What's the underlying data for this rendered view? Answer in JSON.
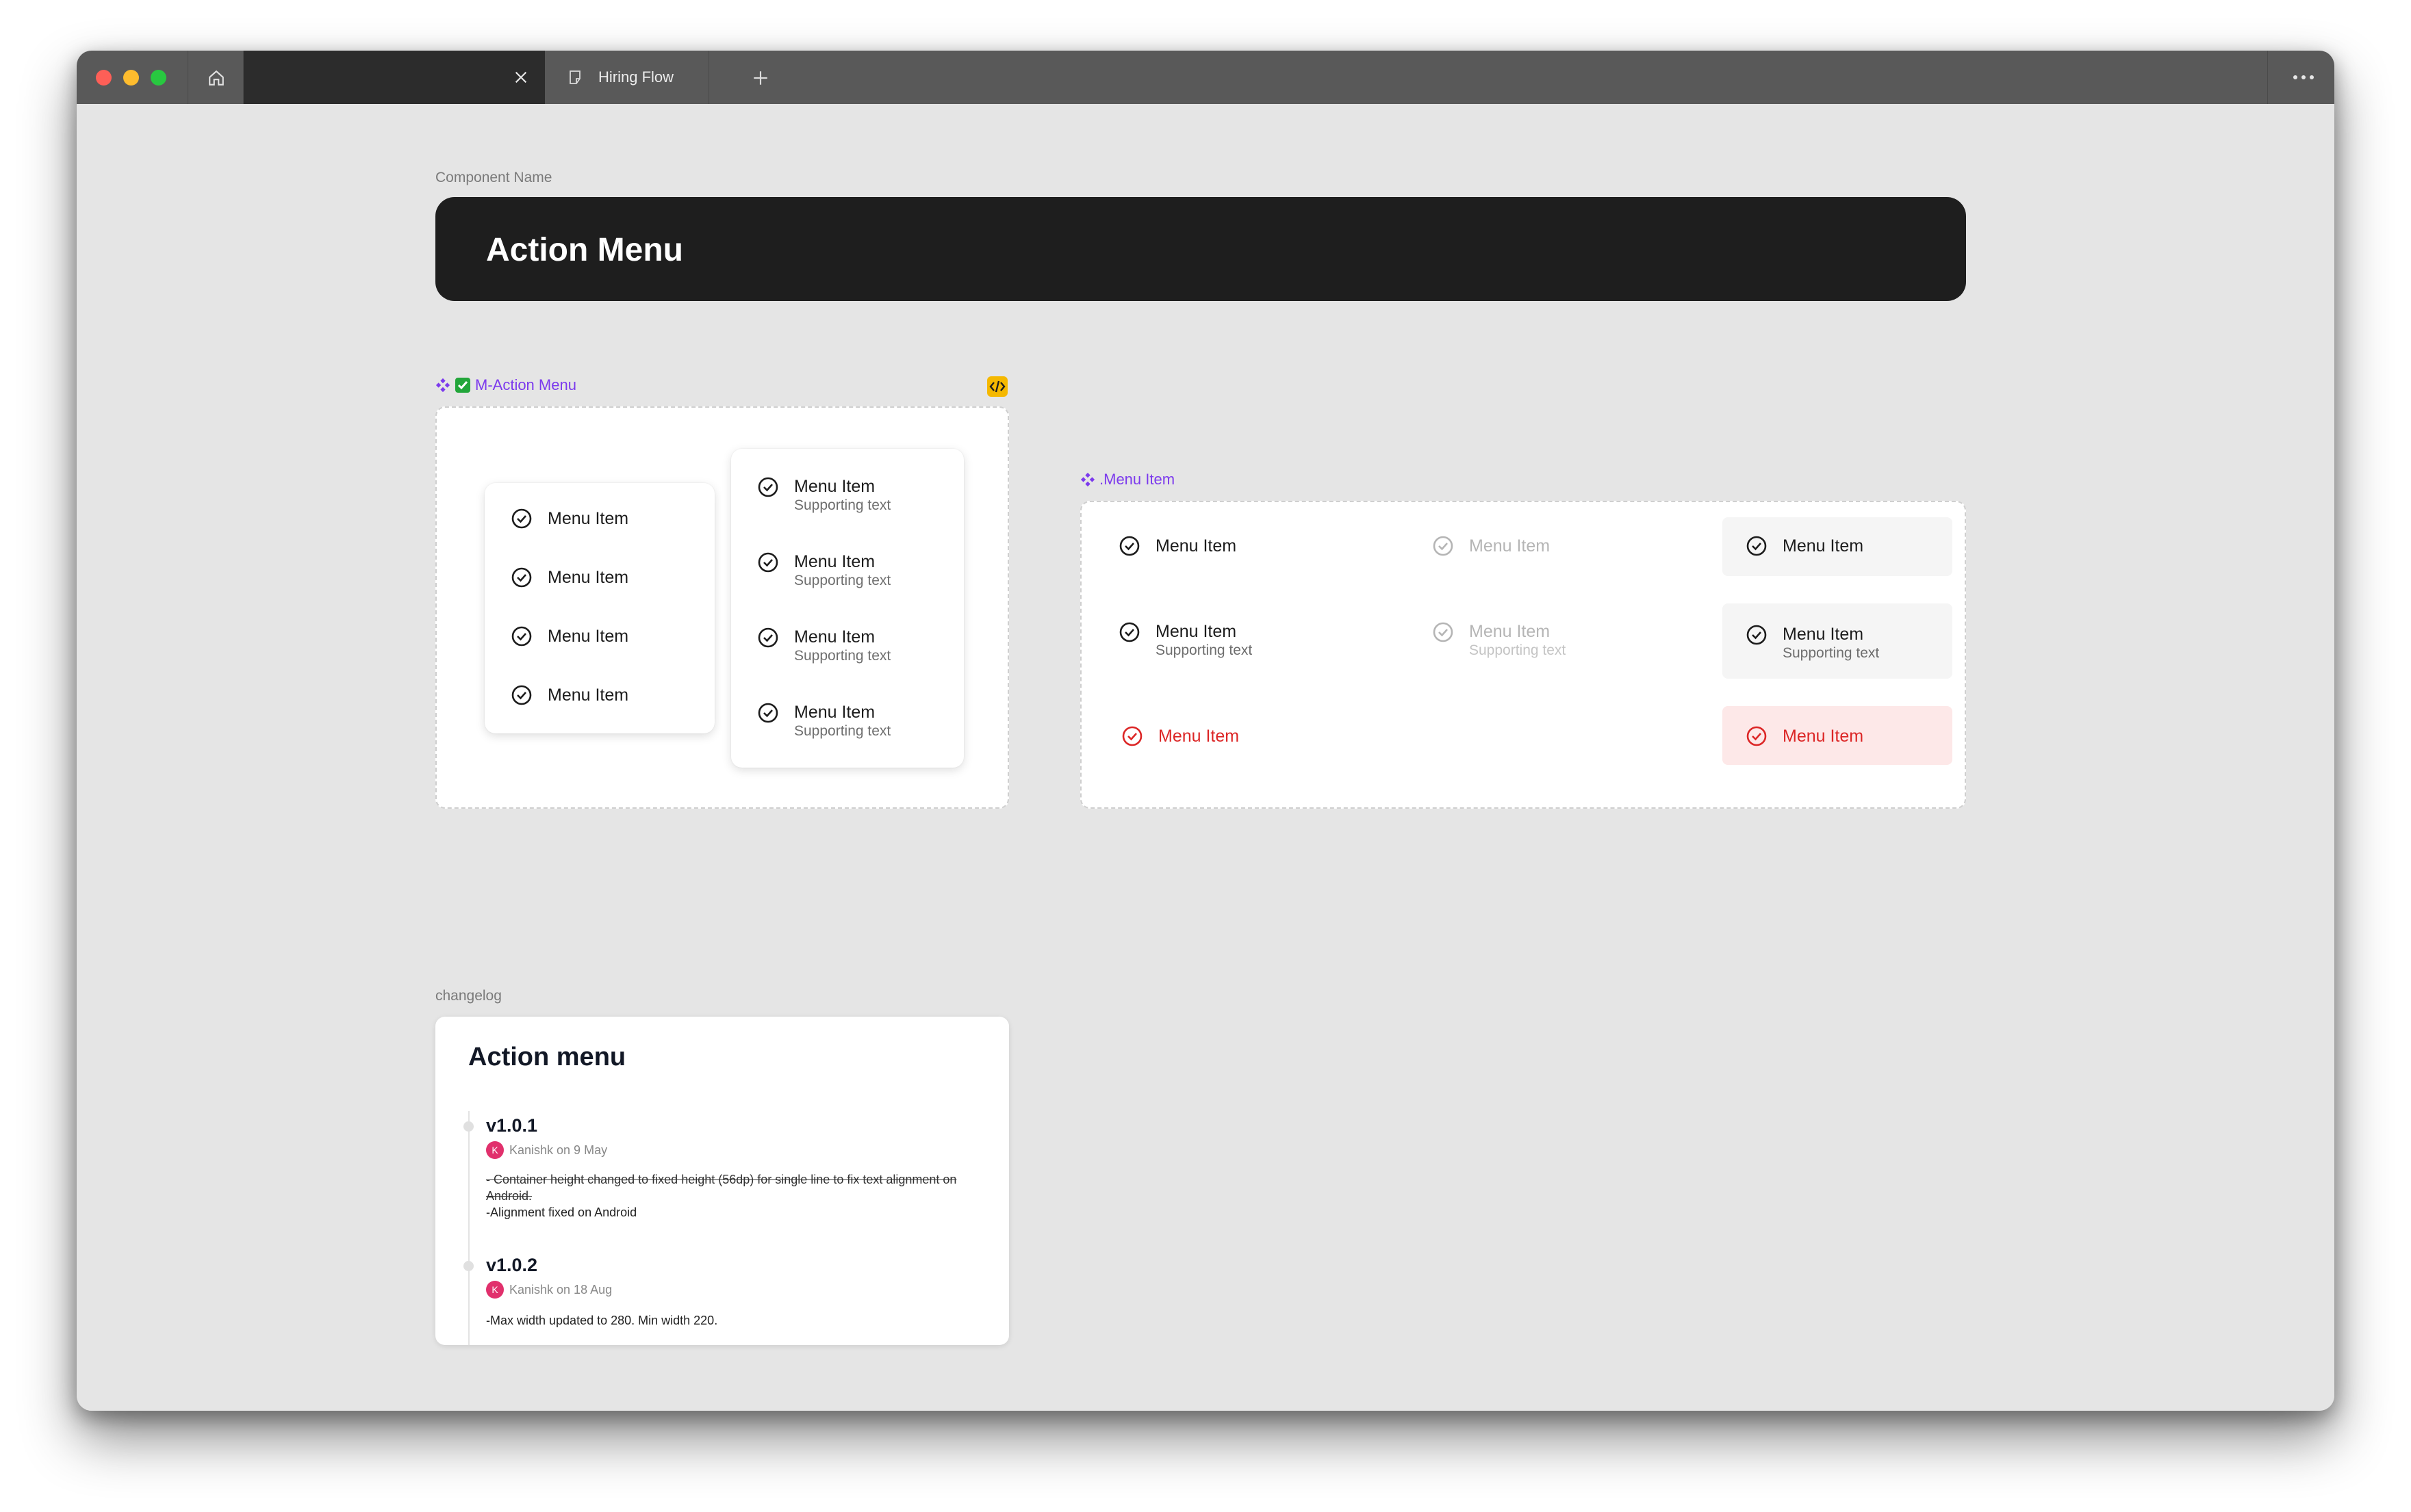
{
  "browser": {
    "home_tab": "home",
    "active_tab": {
      "label": ""
    },
    "tab2": {
      "label": "Hiring Flow"
    },
    "new_tab_label": "+"
  },
  "page": {
    "component_name_label": "Component Name",
    "banner_title": "Action Menu",
    "action_menu_frame_label": "M-Action Menu",
    "menu_item_frame_label": ".Menu Item",
    "changelog_label": "changelog"
  },
  "action_menu_single": {
    "items": [
      "Menu Item",
      "Menu Item",
      "Menu Item",
      "Menu Item"
    ]
  },
  "action_menu_double": {
    "items": [
      {
        "title": "Menu Item",
        "subtitle": "Supporting text"
      },
      {
        "title": "Menu Item",
        "subtitle": "Supporting text"
      },
      {
        "title": "Menu Item",
        "subtitle": "Supporting text"
      },
      {
        "title": "Menu Item",
        "subtitle": "Supporting text"
      }
    ]
  },
  "menu_item_states": {
    "row1": [
      "Menu Item",
      "Menu Item",
      "Menu Item"
    ],
    "row2": [
      {
        "title": "Menu Item",
        "subtitle": "Supporting text"
      },
      {
        "title": "Menu Item",
        "subtitle": "Supporting text"
      },
      {
        "title": "Menu Item",
        "subtitle": "Supporting text"
      }
    ],
    "row3": [
      "Menu Item",
      "Menu Item"
    ]
  },
  "changelog": {
    "title": "Action menu",
    "entries": [
      {
        "version": "v1.0.1",
        "author_initial": "K",
        "author": "Kanishk on 9 May",
        "note_strike": "- Container height changed to fixed height (56dp) for single line to fix text alignment on Android.",
        "note": "-Alignment fixed on Android"
      },
      {
        "version": "v1.0.2",
        "author_initial": "K",
        "author": "Kanishk on 18 Aug",
        "note": "-Max width updated to 280. Min width 220."
      }
    ]
  },
  "colors": {
    "accent_purple": "#7c3aed",
    "danger_red": "#dc2626",
    "danger_bg": "#fde8e8",
    "hover_bg": "#f5f5f5",
    "disabled": "#b5b5b5"
  }
}
